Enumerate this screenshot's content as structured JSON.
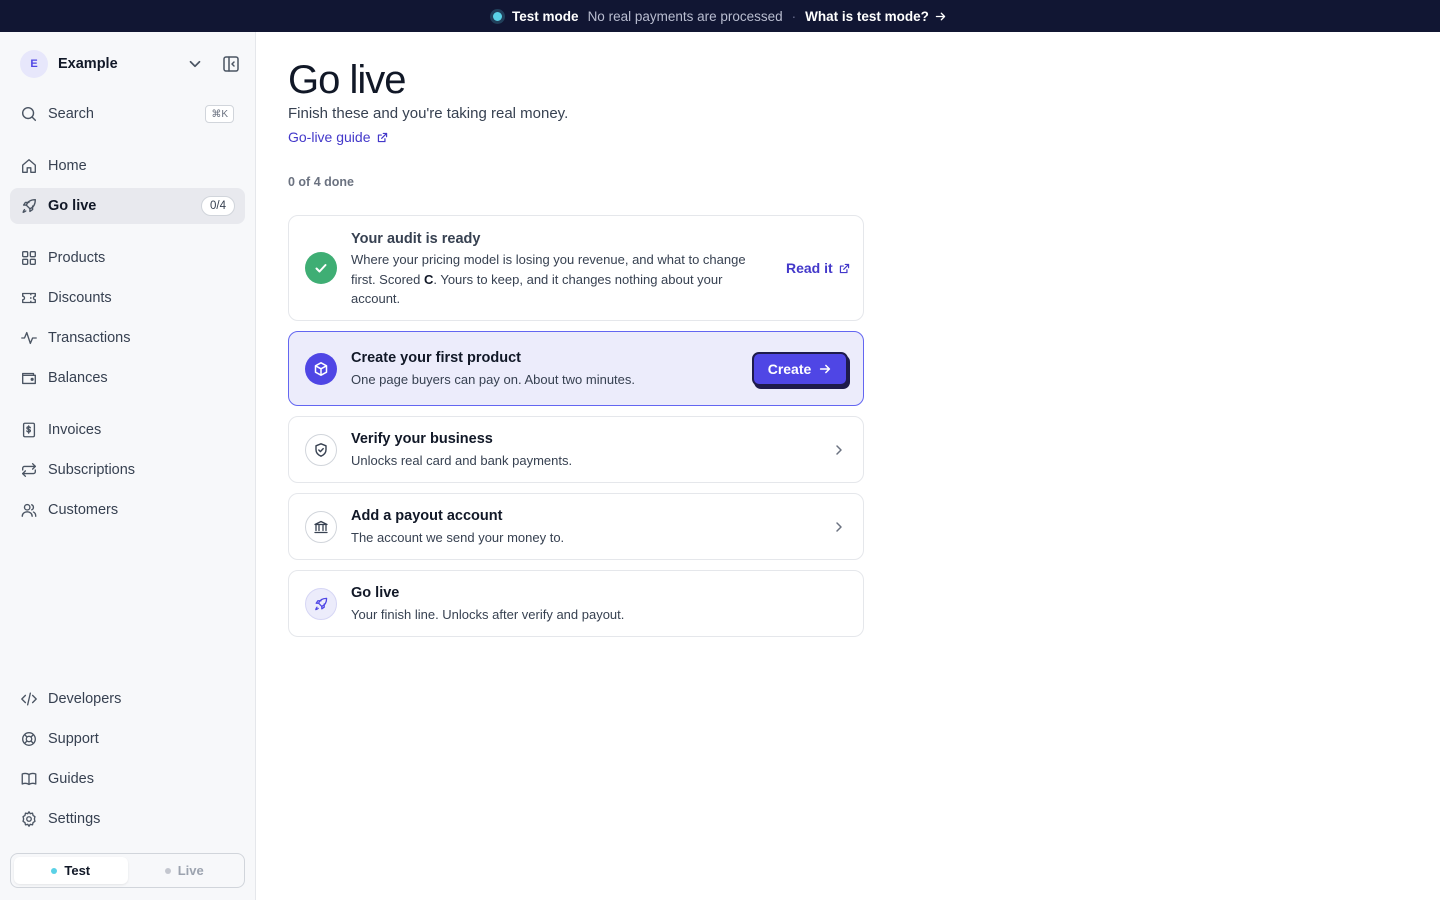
{
  "banner": {
    "mode": "Test mode",
    "note": "No real payments are processed",
    "link": "What is test mode?"
  },
  "sidebar": {
    "workspace": {
      "initial": "E",
      "name": "Example"
    },
    "search": {
      "label": "Search",
      "shortcut": "⌘K"
    },
    "nav": [
      {
        "label": "Home",
        "icon": "home-icon"
      },
      {
        "label": "Go live",
        "icon": "rocket-icon",
        "badge": "0/4",
        "active": true
      },
      {
        "label": "Products",
        "icon": "grid-icon"
      },
      {
        "label": "Discounts",
        "icon": "ticket-icon"
      },
      {
        "label": "Transactions",
        "icon": "activity-icon"
      },
      {
        "label": "Balances",
        "icon": "wallet-icon"
      },
      {
        "label": "Invoices",
        "icon": "invoice-icon"
      },
      {
        "label": "Subscriptions",
        "icon": "repeat-icon"
      },
      {
        "label": "Customers",
        "icon": "users-icon"
      }
    ],
    "footer_nav": [
      {
        "label": "Developers",
        "icon": "code-icon"
      },
      {
        "label": "Support",
        "icon": "lifebuoy-icon"
      },
      {
        "label": "Guides",
        "icon": "book-icon"
      },
      {
        "label": "Settings",
        "icon": "gear-icon"
      }
    ],
    "mode_switch": {
      "test": "Test",
      "live": "Live"
    }
  },
  "main": {
    "title": "Go live",
    "subtitle": "Finish these and you're taking real money.",
    "guide_link": "Go-live guide",
    "progress": "0 of 4 done",
    "audit": {
      "title": "Your audit is ready",
      "desc_before": "Where your pricing model is losing you revenue, and what to change first. Scored ",
      "score": "C",
      "desc_after": ". Yours to keep, and it changes nothing about your account.",
      "action": "Read it"
    },
    "tasks": [
      {
        "title": "Create your first product",
        "desc": "One page buyers can pay on. About two minutes.",
        "action": "Create"
      },
      {
        "title": "Verify your business",
        "desc": "Unlocks real card and bank payments."
      },
      {
        "title": "Add a payout account",
        "desc": "The account we send your money to."
      },
      {
        "title": "Go live",
        "desc": "Your finish line. Unlocks after verify and payout."
      }
    ]
  },
  "colors": {
    "accent": "#4f46e5",
    "banner_bg": "#111633",
    "success": "#3fae74",
    "test_dot": "#5ad1e6"
  }
}
